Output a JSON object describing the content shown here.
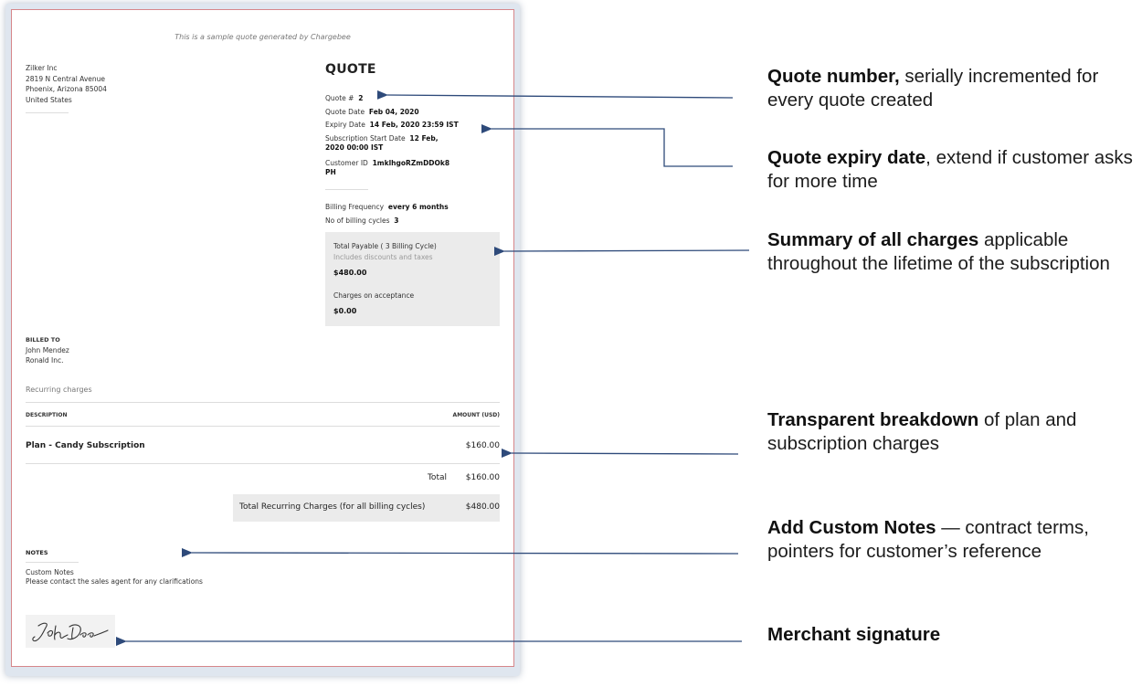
{
  "document": {
    "sample_note": "This is a sample quote generated by Chargebee",
    "merchant": {
      "name": "Zilker Inc",
      "address_line1": "2819 N Central Avenue",
      "address_line2": "Phoenix, Arizona 85004",
      "country": "United States"
    },
    "quote_title": "QUOTE",
    "quote_number": {
      "label": "Quote #",
      "value": "2"
    },
    "quote_date": {
      "label": "Quote Date",
      "value": "Feb 04, 2020"
    },
    "expiry_date": {
      "label": "Expiry Date",
      "value": "14 Feb, 2020 23:59 IST"
    },
    "subscription_start": {
      "label": "Subscription Start Date",
      "value_line1": "12 Feb,",
      "value_line2": "2020 00:00 IST"
    },
    "customer_id": {
      "label": "Customer ID",
      "value_line1": "1mklhgoRZmDDOk8",
      "value_line2": "PH"
    },
    "billing_frequency": {
      "label": "Billing Frequency",
      "value": "every 6 months"
    },
    "billing_cycles": {
      "label": "No of billing cycles",
      "value": "3"
    },
    "summary": {
      "total_payable_label": "Total Payable ( 3 Billing Cycle)",
      "includes_note": "Includes discounts and taxes",
      "total_payable_value": "$480.00",
      "charges_on_acceptance_label": "Charges on acceptance",
      "charges_on_acceptance_value": "$0.00"
    },
    "billed_to": {
      "heading": "BILLED TO",
      "name": "John Mendez",
      "company": "Ronald Inc."
    },
    "recurring_label": "Recurring charges",
    "table": {
      "col_description": "DESCRIPTION",
      "col_amount": "AMOUNT (USD)",
      "rows": [
        {
          "description": "Plan - Candy Subscription",
          "amount": "$160.00"
        }
      ],
      "total_label": "Total",
      "total_value": "$160.00",
      "recurring_total_label": "Total Recurring Charges (for all billing cycles)",
      "recurring_total_value": "$480.00"
    },
    "notes": {
      "heading": "NOTES",
      "line1": "Custom Notes",
      "line2": "Please contact the sales agent for any clarifications"
    },
    "signature_text": "John Doe"
  },
  "callouts": [
    {
      "bold": "Quote number,",
      "rest": " serially incremented for every quote created"
    },
    {
      "bold": "Quote expiry date",
      "rest": ", extend if customer asks for more time"
    },
    {
      "bold": "Summary of all charges",
      "rest": " applicable throughout the lifetime of the subscription"
    },
    {
      "bold": "Transparent breakdown",
      "rest": " of plan and subscription charges"
    },
    {
      "bold": "Add Custom Notes",
      "rest": " — contract terms, pointers for customer’s reference"
    },
    {
      "bold": "Merchant signature",
      "rest": ""
    }
  ],
  "colors": {
    "arrow": "#2e4a7a",
    "doc_border": "#d6868a",
    "summary_bg": "#ebebeb"
  }
}
